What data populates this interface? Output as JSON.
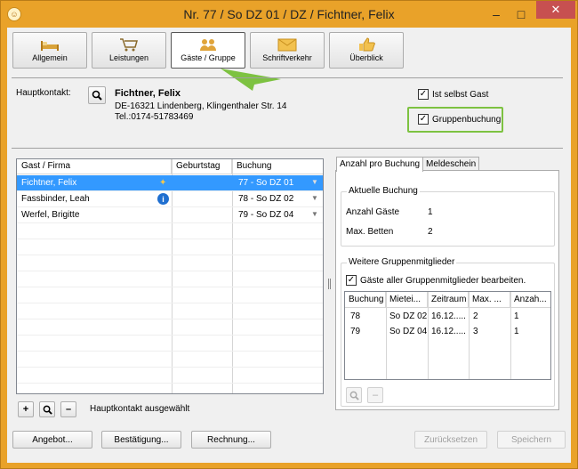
{
  "window": {
    "title": "Nr. 77 / So DZ 01 / DZ / Fichtner, Felix"
  },
  "toolbar": [
    {
      "label": "Allgemein",
      "icon": "bed-icon"
    },
    {
      "label": "Leistungen",
      "icon": "cart-icon"
    },
    {
      "label": "Gäste / Gruppe",
      "icon": "people-icon"
    },
    {
      "label": "Schriftverkehr",
      "icon": "envelope-icon"
    },
    {
      "label": "Überblick",
      "icon": "thumbs-up-icon"
    }
  ],
  "contact": {
    "label": "Hauptkontakt:",
    "name": "Fichtner, Felix",
    "address": "DE-16321 Lindenberg, Klingenthaler Str. 14",
    "phone": "Tel.:0174-51783469",
    "self_guest_label": "Ist selbst Gast",
    "self_guest": true,
    "group_booking_label": "Gruppenbuchung",
    "group_booking": true
  },
  "guests": {
    "columns": [
      "Gast / Firma",
      "Geburtstag",
      "Buchung"
    ],
    "rows": [
      {
        "name": "Fichtner, Felix",
        "birthday": "",
        "booking": "77 - So DZ 01",
        "selected": true,
        "badge": "star"
      },
      {
        "name": "Fassbinder, Leah",
        "birthday": "",
        "booking": "78 - So DZ 02",
        "selected": false,
        "badge": "info"
      },
      {
        "name": "Werfel, Brigitte",
        "birthday": "",
        "booking": "79 - So DZ 04",
        "selected": false,
        "badge": ""
      }
    ],
    "status": "Hauptkontakt ausgewählt"
  },
  "tabs": [
    "Anzahl pro Buchung",
    "Meldeschein"
  ],
  "current_booking": {
    "title": "Aktuelle Buchung",
    "guests_label": "Anzahl Gäste",
    "guests_value": "1",
    "beds_label": "Max. Betten",
    "beds_value": "2"
  },
  "members": {
    "title": "Weitere Gruppenmitglieder",
    "edit_all_label": "Gäste aller Gruppenmitglieder bearbeiten.",
    "edit_all": true,
    "columns": [
      "Buchung",
      "Mietei...",
      "Zeitraum",
      "Max. ...",
      "Anzah..."
    ],
    "rows": [
      [
        "78",
        "So DZ 02",
        "16.12.....",
        "2",
        "1"
      ],
      [
        "79",
        "So DZ 04",
        "16.12.....",
        "3",
        "1"
      ]
    ]
  },
  "footer": {
    "offer": "Angebot...",
    "confirm": "Bestätigung...",
    "invoice": "Rechnung...",
    "reset": "Zurücksetzen",
    "save": "Speichern"
  },
  "colors": {
    "accent": "#7dc241",
    "title_bar": "#e9a229",
    "selection": "#3399ff"
  }
}
